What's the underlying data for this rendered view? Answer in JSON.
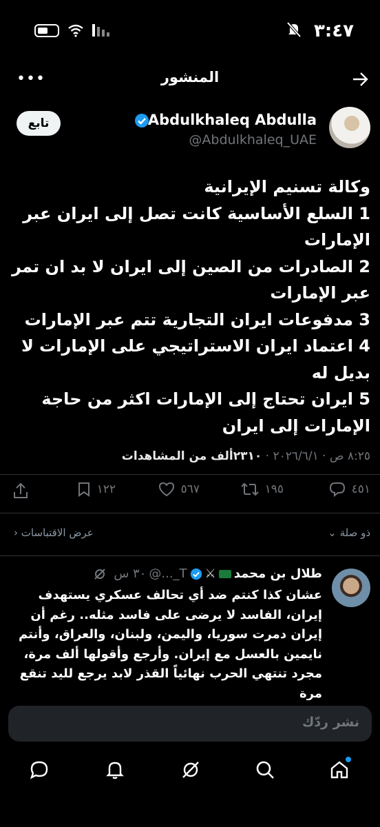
{
  "status_bar": {
    "time": "٣:٤٧"
  },
  "header": {
    "title": "المنشور"
  },
  "post": {
    "display_name": "Abdulkhaleq Abdulla",
    "handle": "@Abdulkhaleq_UAE",
    "follow_label": "تابع",
    "body": "وكالة تسنيم الإيرانية\n1 السلع الأساسية كانت تصل إلى ايران عبر الإمارات\n2 الصادرات من الصين إلى ايران لا بد ان تمر عبر الإمارات\n3 مدفوعات ايران التجارية تتم عبر الإمارات\n4 اعتماد ايران الاستراتيجي على الإمارات لا بديل له\n5 ايران تحتاج إلى الإمارات اكثر من حاجة الإمارات إلى ايران",
    "timestamp": "٨:٢٥ ص · ٢٠٢٦/٦/١ · ",
    "views_count": "٢٣١٠",
    "views_label": "ألف من المشاهدات",
    "replies": "٤٥١",
    "reposts": "١٩٥",
    "likes": "٥٦٧",
    "bookmarks": "١٢٢"
  },
  "thread": {
    "relevance_label": "ذو صلة",
    "quotes_label": "عرض الاقتباسات"
  },
  "reply": {
    "name": "طلال بن محمد",
    "handle": "T_...@",
    "time": "٣٠ س",
    "text": "عشان كذا كنتم ضد أي تحالف عسكري يستهدف إيران، الفاسد لا يرضى على فاسد مثله.. رغم أن إيران دمرت سوريا، واليمن، ولبنان، والعراق، وأنتم نايمين بالعسل مع إيران. وأرجع وأقولها ألف مرة، مجرد تنتهي الحرب نهائياً القذر لابد يرجع لليد تنقع مرة"
  },
  "compose": {
    "placeholder": "نشر ردّك"
  },
  "colors": {
    "accent": "#1d9bf0",
    "background": "#000000",
    "muted": "#71767b"
  }
}
